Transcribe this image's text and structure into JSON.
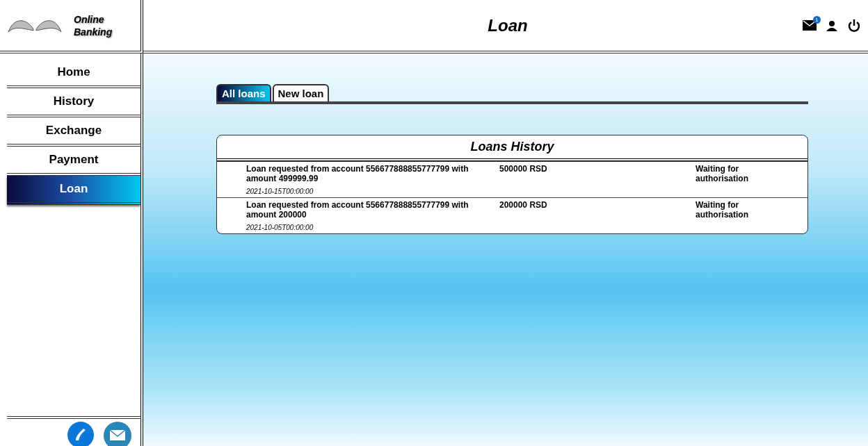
{
  "logo": {
    "text": "Online Banking"
  },
  "header": {
    "title": "Loan",
    "notifications": "1"
  },
  "nav": [
    {
      "label": "Home",
      "selected": false
    },
    {
      "label": "History",
      "selected": false
    },
    {
      "label": "Exchange",
      "selected": false
    },
    {
      "label": "Payment",
      "selected": false
    },
    {
      "label": "Loan",
      "selected": true
    }
  ],
  "tabs": [
    {
      "label": "All loans",
      "selected": true
    },
    {
      "label": "New loan",
      "selected": false
    }
  ],
  "loans": {
    "title": "Loans History",
    "rows": [
      {
        "description": "Loan requested from account 556677888855777799 with amount 499999.99",
        "date": "2021-10-15T00:00:00",
        "amount": "500000 RSD",
        "status": "Waiting for authorisation"
      },
      {
        "description": "Loan requested from account 556677888855777799 with amount 200000",
        "date": "2021-10-05T00:00:00",
        "amount": "200000 RSD",
        "status": "Waiting for authorisation"
      }
    ]
  }
}
